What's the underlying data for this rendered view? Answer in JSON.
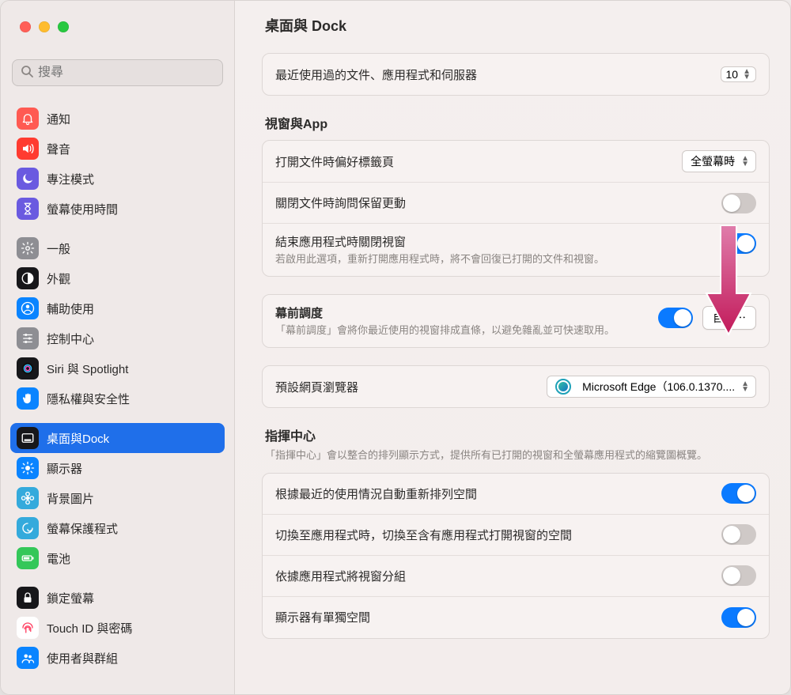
{
  "window": {
    "title": "桌面與 Dock"
  },
  "search": {
    "placeholder": "搜尋"
  },
  "sidebar": {
    "group1": [
      {
        "name": "notifications",
        "label": "通知",
        "bg": "#ff5a52",
        "glyph": "bell"
      },
      {
        "name": "sound",
        "label": "聲音",
        "bg": "#ff3b30",
        "glyph": "speaker"
      },
      {
        "name": "focus",
        "label": "專注模式",
        "bg": "#6a5ae0",
        "glyph": "moon"
      },
      {
        "name": "screentime",
        "label": "螢幕使用時間",
        "bg": "#6a5ae0",
        "glyph": "hourglass"
      }
    ],
    "group2": [
      {
        "name": "general",
        "label": "一般",
        "bg": "#8e8e93",
        "glyph": "gear"
      },
      {
        "name": "appearance",
        "label": "外觀",
        "bg": "#17171a",
        "glyph": "contrast"
      },
      {
        "name": "accessibility",
        "label": "輔助使用",
        "bg": "#0a84ff",
        "glyph": "person"
      },
      {
        "name": "control-center",
        "label": "控制中心",
        "bg": "#8e8e93",
        "glyph": "sliders"
      },
      {
        "name": "siri",
        "label": "Siri 與 Spotlight",
        "bg": "#17171a",
        "glyph": "siri"
      },
      {
        "name": "privacy",
        "label": "隱私權與安全性",
        "bg": "#0a84ff",
        "glyph": "hand"
      }
    ],
    "group3": [
      {
        "name": "dock",
        "label": "桌面與Dock",
        "bg": "#17171a",
        "glyph": "dock",
        "selected": true
      },
      {
        "name": "displays",
        "label": "顯示器",
        "bg": "#0a84ff",
        "glyph": "sun"
      },
      {
        "name": "wallpaper",
        "label": "背景圖片",
        "bg": "#34aadc",
        "glyph": "flower"
      },
      {
        "name": "screensaver",
        "label": "螢幕保護程式",
        "bg": "#34aadc",
        "glyph": "swirl"
      },
      {
        "name": "battery",
        "label": "電池",
        "bg": "#34c759",
        "glyph": "battery"
      }
    ],
    "group4": [
      {
        "name": "lock",
        "label": "鎖定螢幕",
        "bg": "#17171a",
        "glyph": "lock"
      },
      {
        "name": "touchid",
        "label": "Touch ID 與密碼",
        "bg": "#fff",
        "fg": "#ff4264",
        "glyph": "fingerprint"
      },
      {
        "name": "users",
        "label": "使用者與群組",
        "bg": "#0a84ff",
        "glyph": "users"
      }
    ]
  },
  "recent": {
    "label": "最近使用過的文件、應用程式和伺服器",
    "value": "10"
  },
  "windowsApps": {
    "heading": "視窗與App",
    "tabs": {
      "label": "打開文件時偏好標籤頁",
      "value": "全螢幕時"
    },
    "askChanges": {
      "label": "關閉文件時詢問保留更動",
      "on": false
    },
    "quitClose": {
      "label": "結束應用程式時關閉視窗",
      "sub": "若啟用此選項，重新打開應用程式時，將不會回復已打開的文件和視窗。",
      "on": true
    },
    "stageManager": {
      "label": "幕前調度",
      "sub": "「幕前調度」會將你最近使用的視窗排成直條，以避免雜亂並可快速取用。",
      "on": true,
      "button": "自訂⋯"
    },
    "browser": {
      "label": "預設網頁瀏覽器",
      "value": "Microsoft Edge（106.0.1370...."
    }
  },
  "missionControl": {
    "heading": "指揮中心",
    "sub": "「指揮中心」會以整合的排列顯示方式，提供所有已打開的視窗和全螢幕應用程式的縮覽圖概覽。",
    "autoArrange": {
      "label": "根據最近的使用情況自動重新排列空間",
      "on": true
    },
    "switchSpace": {
      "label": "切換至應用程式時，切換至含有應用程式打開視窗的空間",
      "on": false
    },
    "groupByApp": {
      "label": "依據應用程式將視窗分組",
      "on": false
    },
    "separateSpaces": {
      "label": "顯示器有單獨空間",
      "on": true
    }
  }
}
